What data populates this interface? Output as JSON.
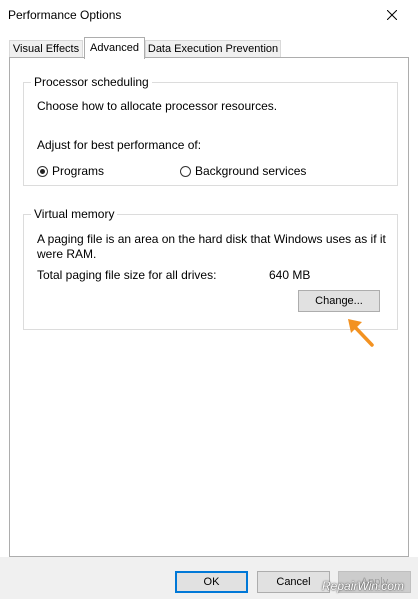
{
  "window": {
    "title": "Performance Options"
  },
  "tabs": [
    {
      "label": "Visual Effects"
    },
    {
      "label": "Advanced"
    },
    {
      "label": "Data Execution Prevention"
    }
  ],
  "processor": {
    "legend": "Processor scheduling",
    "description": "Choose how to allocate processor resources.",
    "adjust_label": "Adjust for best performance of:",
    "options": [
      {
        "label": "Programs",
        "selected": true
      },
      {
        "label": "Background services",
        "selected": false
      }
    ]
  },
  "virtual_memory": {
    "legend": "Virtual memory",
    "description_line1": "A paging file is an area on the hard disk that Windows uses as if it",
    "description_line2": "were RAM.",
    "total_label": "Total paging file size for all drives:",
    "total_value": "640 MB",
    "change_label": "Change..."
  },
  "dialog_buttons": {
    "ok": "OK",
    "cancel": "Cancel",
    "apply": "Apply"
  },
  "watermark": "RepairWin.com",
  "colors": {
    "annotation_arrow": "#f39221",
    "default_button_border": "#0078d7"
  },
  "icons": {
    "close": "close-icon",
    "arrow": "annotation-arrow-icon"
  }
}
